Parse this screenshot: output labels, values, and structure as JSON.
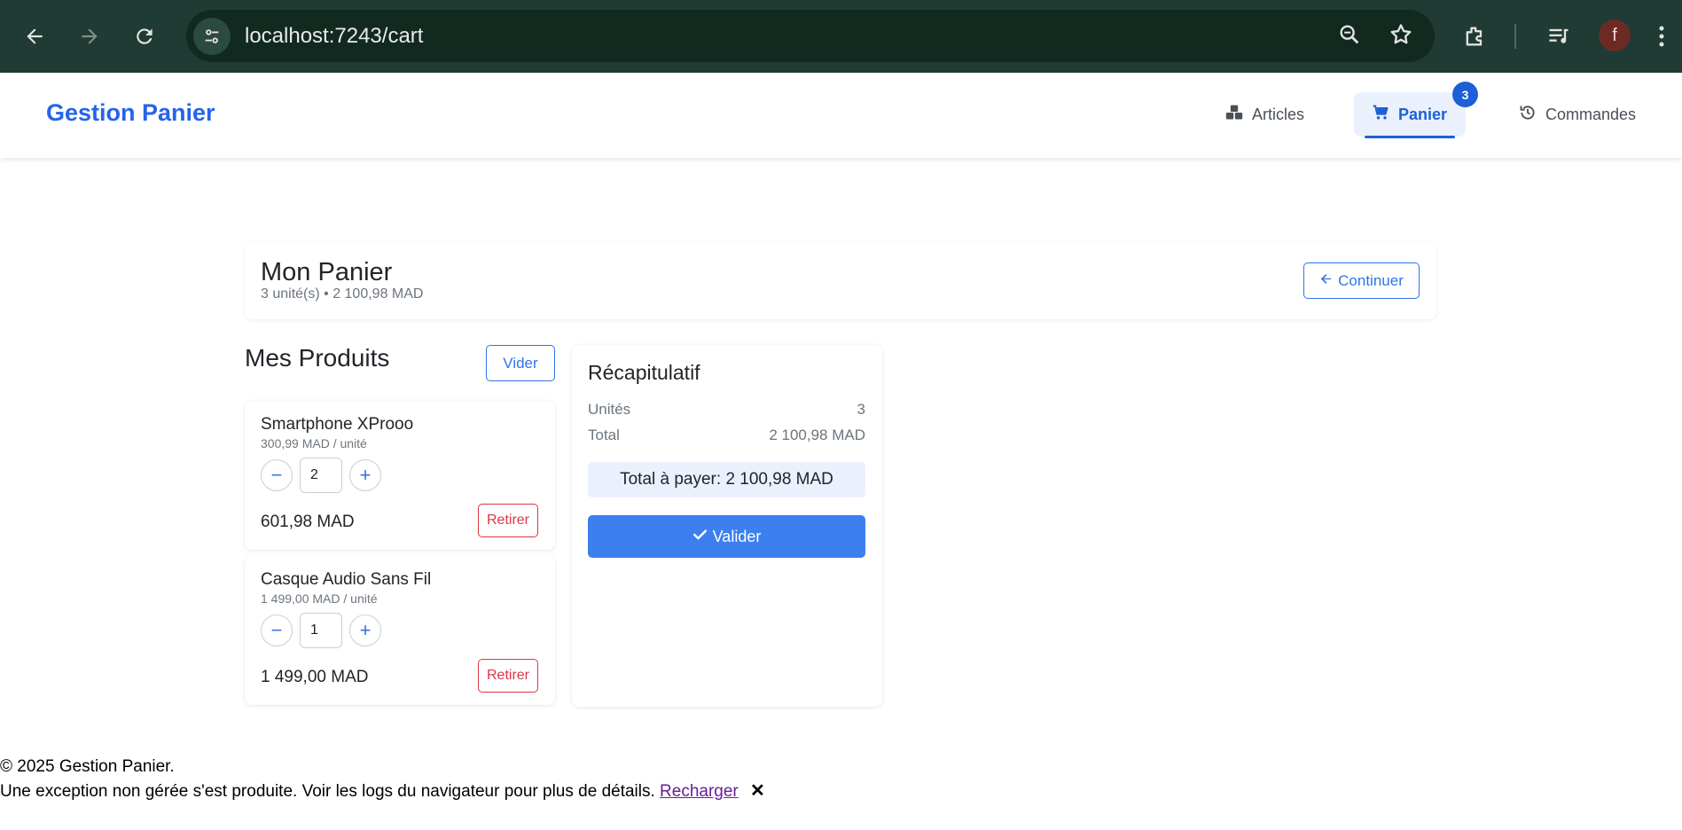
{
  "browser": {
    "url": "localhost:7243/cart",
    "avatar_letter": "f",
    "icons": [
      "back-arrow-icon",
      "forward-arrow-icon",
      "reload-icon",
      "site-info-icon",
      "zoom-icon",
      "star-icon",
      "extensions-icon",
      "media-playlist-icon",
      "more-vert-icon"
    ]
  },
  "navbar": {
    "brand": "Gestion Panier",
    "items": [
      {
        "label": "Articles",
        "icon": "cubes-icon"
      },
      {
        "label": "Panier",
        "icon": "cart-icon"
      },
      {
        "label": "Commandes",
        "icon": "history-icon"
      }
    ],
    "cart_badge": "3",
    "accent": "#2563eb"
  },
  "cart_header": {
    "title": "Mon Panier",
    "subtitle": "3 unité(s) • 2 100,98 MAD",
    "continue_label": "Continuer"
  },
  "products_section": {
    "title": "Mes Produits",
    "clear_label": "Vider",
    "items": [
      {
        "name": "Smartphone XProoo",
        "unit_price": "300,99 MAD / unité",
        "quantity": "2",
        "subtotal": "601,98 MAD",
        "remove_label": "Retirer"
      },
      {
        "name": "Casque Audio Sans Fil",
        "unit_price": "1 499,00 MAD / unité",
        "quantity": "1",
        "subtotal": "1 499,00 MAD",
        "remove_label": "Retirer"
      }
    ],
    "minus": "−",
    "plus": "+"
  },
  "summary": {
    "title": "Récapitulatif",
    "units_label": "Unités",
    "units_value": "3",
    "total_label": "Total",
    "total_value": "2 100,98 MAD",
    "total_to_pay": "Total à payer: 2 100,98 MAD",
    "validate_label": "Valider"
  },
  "footer": {
    "copyright": "© 2025 Gestion Panier.",
    "error_message": "Une exception non gérée s'est produite. Voir les logs du navigateur pour plus de détails.",
    "reload_label": "Recharger",
    "dismiss": "✕"
  }
}
